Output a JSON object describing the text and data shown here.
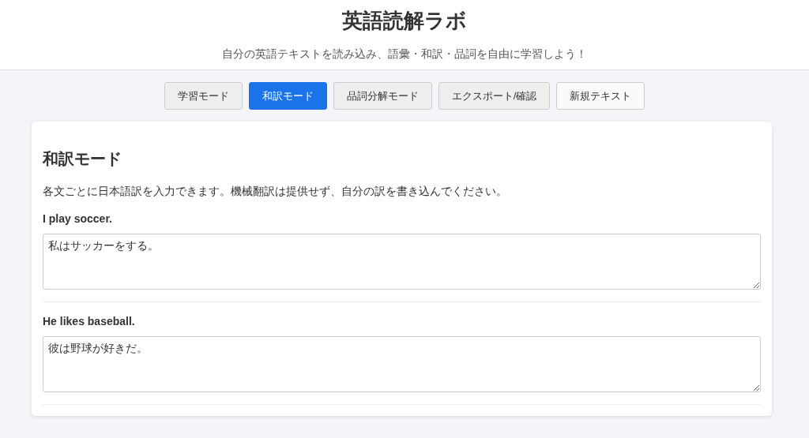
{
  "header": {
    "title": "英語読解ラボ",
    "subtitle": "自分の英語テキストを読み込み、語彙・和訳・品詞を自由に学習しよう！"
  },
  "tabs": [
    {
      "label": "学習モード",
      "selected": false
    },
    {
      "label": "和訳モード",
      "selected": true
    },
    {
      "label": "品詞分解モード",
      "selected": false
    },
    {
      "label": "エクスポート/確認",
      "selected": false
    },
    {
      "label": "新規テキスト",
      "selected": false,
      "kind": "plain"
    }
  ],
  "panel": {
    "title": "和訳モード",
    "description": "各文ごとに日本語訳を入力できます。機械翻訳は提供せず、自分の訳を書き込んでください。",
    "sentences": [
      {
        "english": "I play soccer.",
        "translation": "私はサッカーをする。"
      },
      {
        "english": "He likes baseball.",
        "translation": "彼は野球が好きだ。"
      }
    ]
  }
}
